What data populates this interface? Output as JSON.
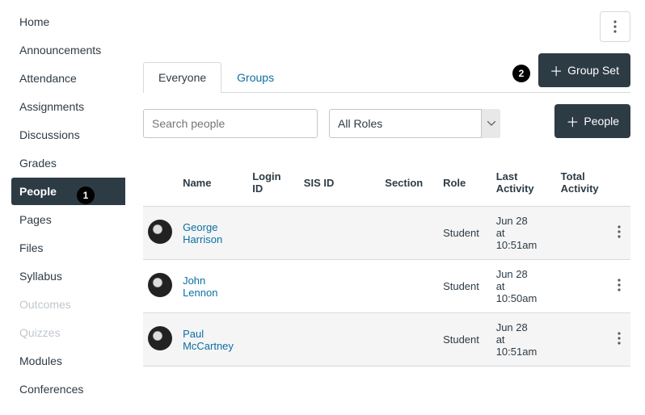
{
  "sidebar": {
    "items": [
      {
        "label": "Home",
        "active": false,
        "disabled": false
      },
      {
        "label": "Announcements",
        "active": false,
        "disabled": false
      },
      {
        "label": "Attendance",
        "active": false,
        "disabled": false
      },
      {
        "label": "Assignments",
        "active": false,
        "disabled": false
      },
      {
        "label": "Discussions",
        "active": false,
        "disabled": false
      },
      {
        "label": "Grades",
        "active": false,
        "disabled": false
      },
      {
        "label": "People",
        "active": true,
        "disabled": false
      },
      {
        "label": "Pages",
        "active": false,
        "disabled": false
      },
      {
        "label": "Files",
        "active": false,
        "disabled": false
      },
      {
        "label": "Syllabus",
        "active": false,
        "disabled": false
      },
      {
        "label": "Outcomes",
        "active": false,
        "disabled": true
      },
      {
        "label": "Quizzes",
        "active": false,
        "disabled": true
      },
      {
        "label": "Modules",
        "active": false,
        "disabled": false
      },
      {
        "label": "Conferences",
        "active": false,
        "disabled": false
      }
    ]
  },
  "markers": {
    "m1": "1",
    "m2": "2"
  },
  "tabs": {
    "everyone": "Everyone",
    "groups": "Groups"
  },
  "buttons": {
    "group_set": "Group Set",
    "people": "People"
  },
  "filters": {
    "search_placeholder": "Search people",
    "role_selected": "All Roles"
  },
  "table": {
    "headers": {
      "name": "Name",
      "login": "Login ID",
      "sis": "SIS ID",
      "section": "Section",
      "role": "Role",
      "last": "Last Activity",
      "total": "Total Activity"
    },
    "rows": [
      {
        "first": "George",
        "last": "Harrison",
        "role": "Student",
        "last_activity": "Jun 28 at 10:51am"
      },
      {
        "first": "John",
        "last": "Lennon",
        "role": "Student",
        "last_activity": "Jun 28 at 10:50am"
      },
      {
        "first": "Paul",
        "last": "McCartney",
        "role": "Student",
        "last_activity": "Jun 28 at 10:51am"
      }
    ]
  }
}
